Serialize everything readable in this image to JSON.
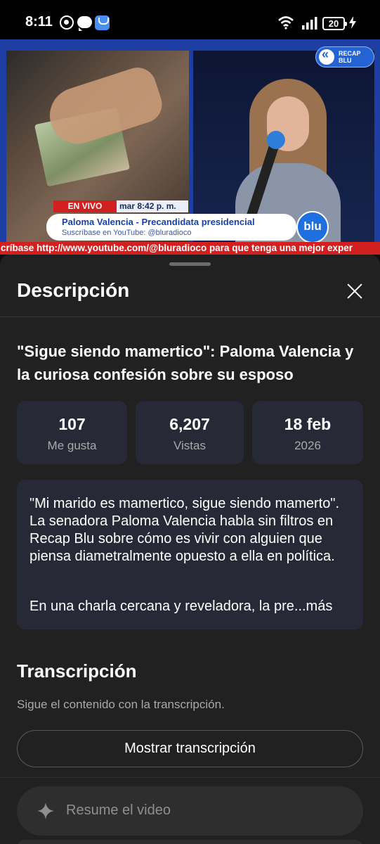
{
  "status_bar": {
    "time": "8:11",
    "battery": "20"
  },
  "video": {
    "live_label": "EN VIVO",
    "live_time": "mar  8:42 p. m.",
    "lower_third_title": "Paloma Valencia - Precandidata presidencial",
    "lower_third_sub": "Suscríbase en YouTube: @bluradioco",
    "recap_logo": "RECAP BLU",
    "blu_logo": "blu",
    "ticker": "críbase http://www.youtube.com/@bluradioco para que tenga una mejor exper"
  },
  "sheet": {
    "title": "Descripción",
    "video_title": "\"Sigue siendo mamertico\": Paloma Valencia y la curiosa confesión sobre su esposo",
    "stats": [
      {
        "value": "107",
        "label": "Me gusta"
      },
      {
        "value": "6,207",
        "label": "Vistas"
      },
      {
        "value": "18 feb",
        "label": "2026"
      }
    ],
    "description": "\"Mi marido es mamertico, sigue siendo mamerto\". La senadora Paloma Valencia habla sin filtros en Recap Blu sobre cómo es vivir con alguien que piensa diametralmente opuesto a ella en política.",
    "description_more": "En una charla cercana y reveladora, la pre...más",
    "transcript": {
      "title": "Transcripción",
      "subtitle": "Sigue el contenido con la transcripción.",
      "button": "Mostrar transcripción"
    },
    "ask_placeholder": "Resume el video"
  },
  "icons": {
    "close": "close-icon",
    "sparkle": "sparkle-icon",
    "wifi": "wifi-icon",
    "signal": "signal-icon",
    "battery": "battery-icon"
  }
}
